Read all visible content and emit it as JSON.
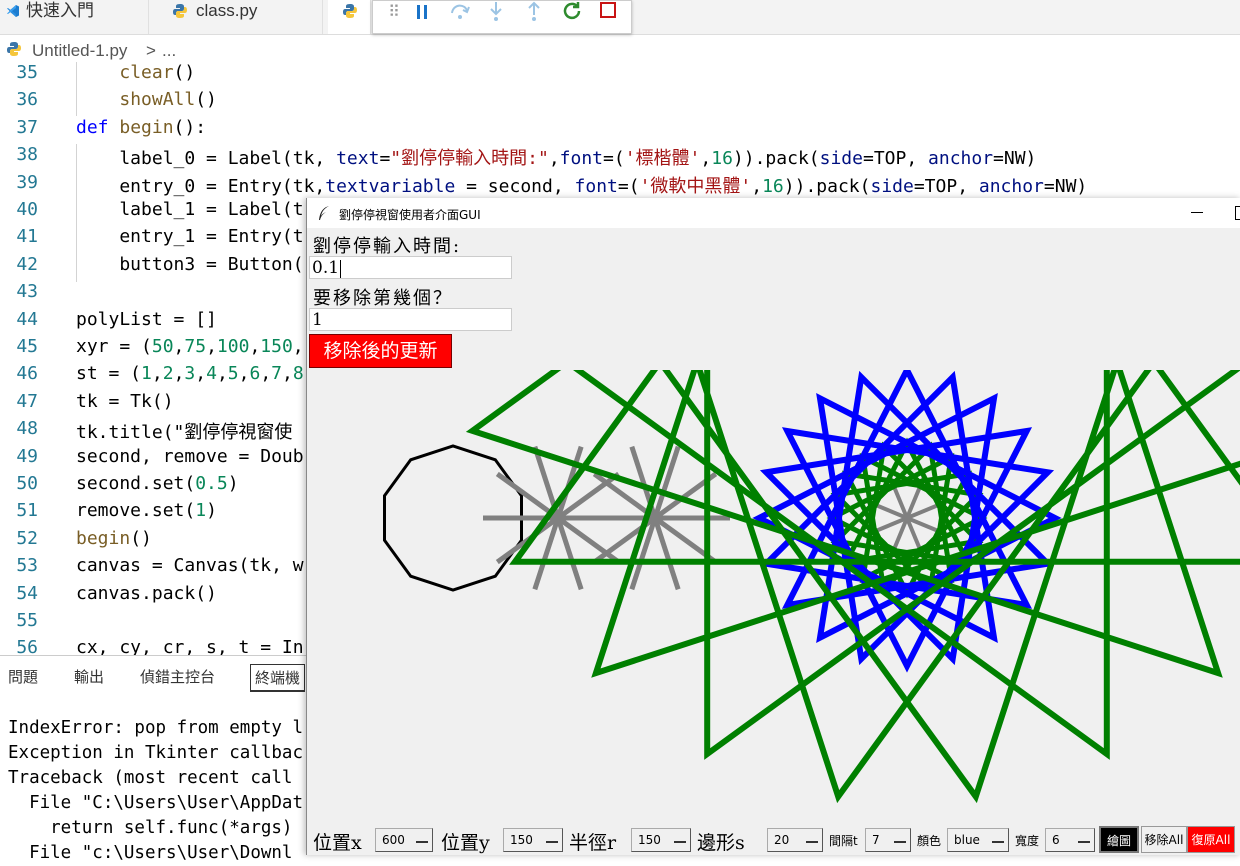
{
  "tabs": [
    {
      "label": "快速入門"
    },
    {
      "label": "class.py"
    }
  ],
  "breadcrumb": {
    "file": "Untitled-1.py",
    "sep": ">",
    "rest": "..."
  },
  "code_lines": [
    {
      "n": "35",
      "text": "    clear()"
    },
    {
      "n": "36",
      "text": "    showAll()"
    },
    {
      "n": "37",
      "text": "def begin():"
    },
    {
      "n": "38",
      "text": "    label_0 = Label(tk, text=\"劉停停輸入時間:\",font=('標楷體',16)).pack(side=TOP, anchor=NW)"
    },
    {
      "n": "39",
      "text": "    entry_0 = Entry(tk,textvariable = second, font=('微軟中黑體',16)).pack(side=TOP, anchor=NW)"
    },
    {
      "n": "40",
      "text": "    label_1 = Label(t"
    },
    {
      "n": "41",
      "text": "    entry_1 = Entry(t"
    },
    {
      "n": "42",
      "text": "    button3 = Button("
    },
    {
      "n": "43",
      "text": ""
    },
    {
      "n": "44",
      "text": "polyList = []"
    },
    {
      "n": "45",
      "text": "xyr = (50,75,100,150,"
    },
    {
      "n": "46",
      "text": "st = (1,2,3,4,5,6,7,8"
    },
    {
      "n": "47",
      "text": "tk = Tk()"
    },
    {
      "n": "48",
      "text": "tk.title(\"劉停停視窗使"
    },
    {
      "n": "49",
      "text": "second, remove = Doub"
    },
    {
      "n": "50",
      "text": "second.set(0.5)"
    },
    {
      "n": "51",
      "text": "remove.set(1)"
    },
    {
      "n": "52",
      "text": "begin()"
    },
    {
      "n": "53",
      "text": "canvas = Canvas(tk, w"
    },
    {
      "n": "54",
      "text": "canvas.pack()"
    },
    {
      "n": "55",
      "text": ""
    },
    {
      "n": "56",
      "text": "cx, cy, cr, s, t = In"
    }
  ],
  "panel": {
    "tabs": [
      "問題",
      "輸出",
      "偵錯主控台",
      "終端機"
    ],
    "active_tab": "終端機",
    "terminal_lines": [
      "IndexError: pop from empty l",
      "Exception in Tkinter callbac",
      "Traceback (most recent call",
      "  File \"C:\\Users\\User\\AppDat",
      "    return self.func(*args)",
      "  File \"c:\\Users\\User\\Downl"
    ]
  },
  "tk_window": {
    "title": "劉停停視窗使用者介面GUI",
    "window_controls": [
      "minimize",
      "maximize"
    ],
    "label_0": "劉停停輸入時間:",
    "entry_0": "0.1",
    "label_1": "要移除第幾個？",
    "entry_1": "1",
    "button3": "移除後的更新",
    "controls": [
      {
        "label": "位置x",
        "value": "600"
      },
      {
        "label": "位置y",
        "value": "150"
      },
      {
        "label": "半徑r",
        "value": "150"
      },
      {
        "label": "邊形s",
        "value": "20"
      },
      {
        "label": "間隔t",
        "value": "7"
      },
      {
        "label": "顏色",
        "value": "blue"
      },
      {
        "label": "寬度",
        "value": "6"
      }
    ],
    "buttons": [
      {
        "label": "繪圖",
        "bg": "#000000",
        "fg": "#ffffff"
      },
      {
        "label": "移除All",
        "bg": "#f0f0f0",
        "fg": "#000000"
      },
      {
        "label": "復原All",
        "bg": "#ff0000",
        "fg": "#ffffff"
      }
    ]
  },
  "colors": {
    "polygon_black": "#000000",
    "star_gray": "#808080",
    "star_blue": "#0000ff",
    "star_green": "#008000",
    "button_red": "#ff0000"
  }
}
